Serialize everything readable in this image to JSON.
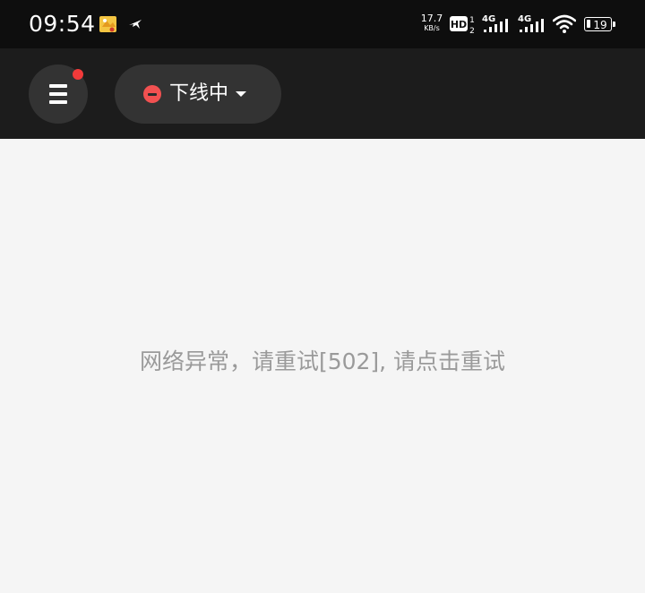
{
  "status_bar": {
    "time": "09:54",
    "net_speed_value": "17.7",
    "net_speed_unit": "KB/s",
    "hd_label": "HD",
    "sim1_label": "4G",
    "sim2_label": "4G",
    "battery_level": "19",
    "icons": [
      "notification-app-icon",
      "plane-icon",
      "hd-voice-icon",
      "signal-icon",
      "signal-icon",
      "wifi-icon",
      "battery-icon"
    ]
  },
  "header": {
    "menu_icon": "hamburger-menu-icon",
    "has_notification_dot": true,
    "status_dropdown": {
      "label": "下线中",
      "icon": "offline-minus-icon",
      "caret_icon": "caret-down-icon"
    }
  },
  "main": {
    "error_message": "网络异常，请重试[502], 请点击重试"
  },
  "colors": {
    "status_bar_bg": "#0e0e0e",
    "header_bg": "#1c1c1c",
    "button_bg": "#333333",
    "notification_dot": "#f23a3a",
    "offline_red": "#f25151",
    "content_bg": "#f5f5f5",
    "error_text": "#9a9a9a"
  }
}
